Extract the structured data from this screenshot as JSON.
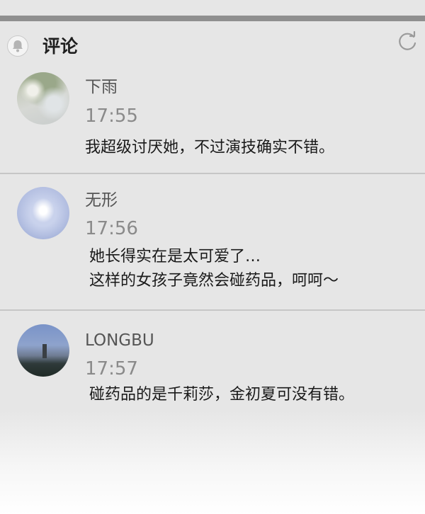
{
  "header": {
    "title": "评论",
    "bell_icon": "bell-icon",
    "refresh_icon": "refresh-icon"
  },
  "comments": [
    {
      "name": "下雨",
      "time": "17:55",
      "lines": [
        "我超级讨厌她，不过演技确实不错。"
      ]
    },
    {
      "name": "无形",
      "time": "17:56",
      "lines": [
        "她长得实在是太可爱了…",
        "这样的女孩子竟然会碰药品，呵呵～"
      ]
    },
    {
      "name": "LONGBU",
      "time": "17:57",
      "lines": [
        "碰药品的是千莉莎，金初夏可没有错。"
      ]
    }
  ]
}
